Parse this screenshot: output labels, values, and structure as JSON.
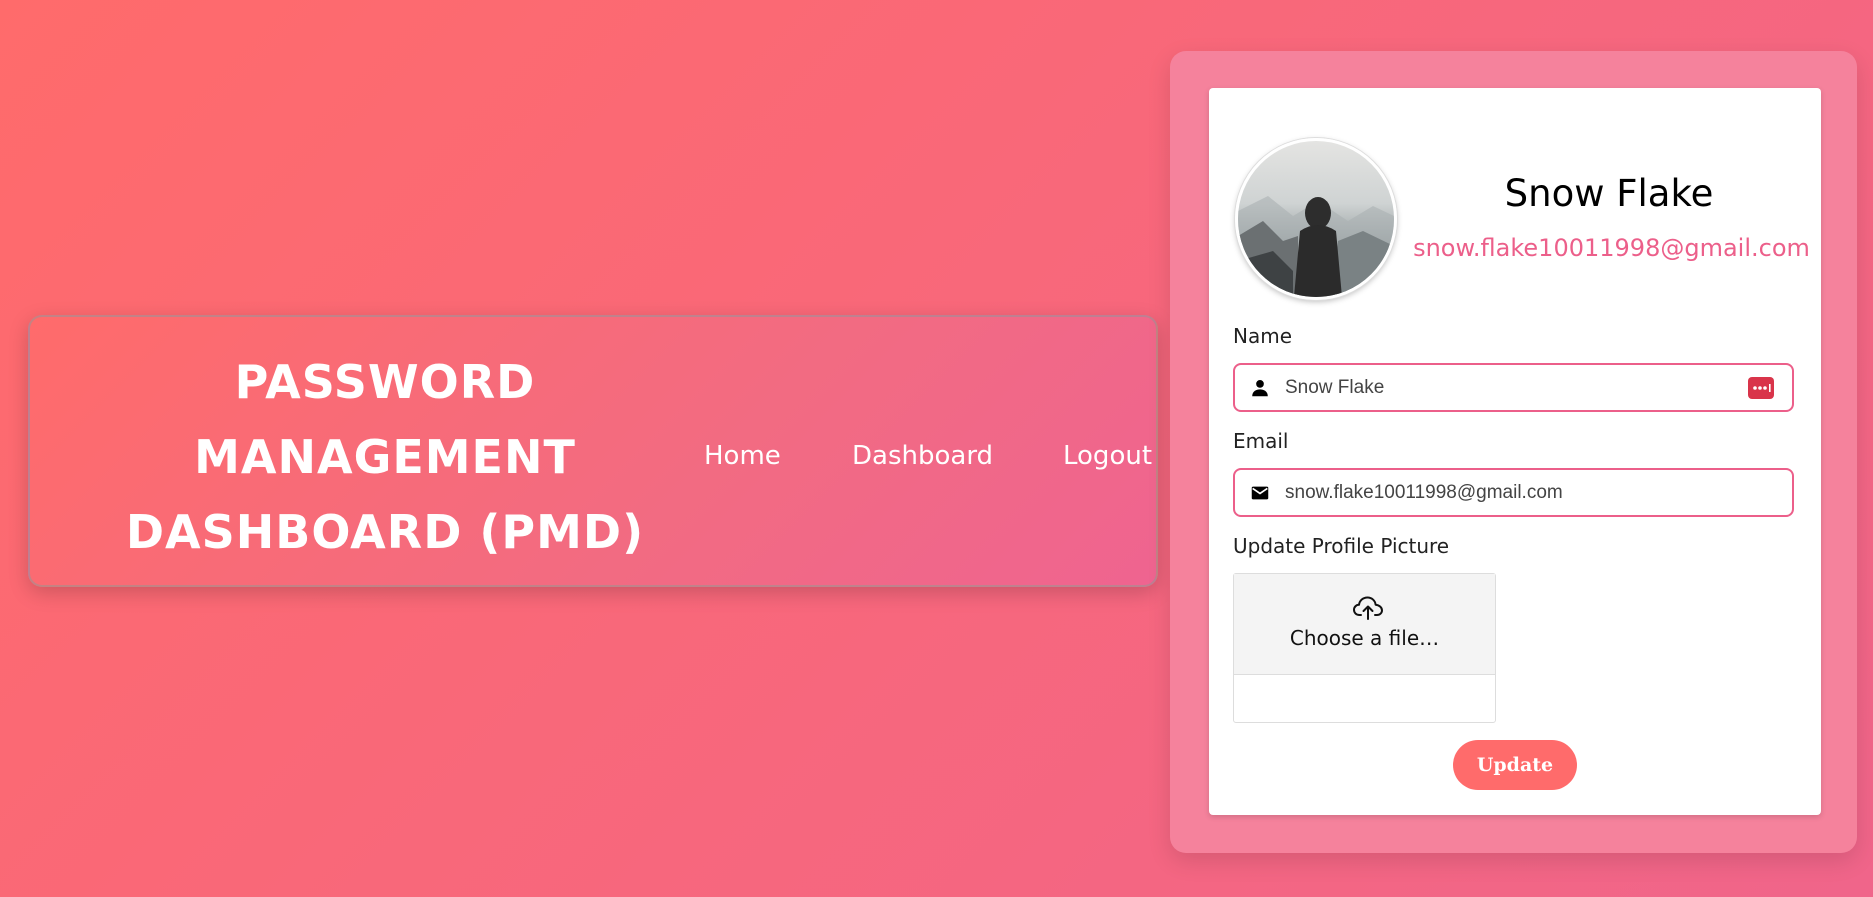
{
  "navbar": {
    "brand_line1": "PASSWORD",
    "brand_line2": "MANAGEMENT",
    "brand_line3": "DASHBOARD (PMD)",
    "links": [
      {
        "label": "Home"
      },
      {
        "label": "Dashboard"
      },
      {
        "label": "Logout"
      }
    ]
  },
  "profile": {
    "name": "Snow Flake",
    "email": "snow.flake10011998@gmail.com",
    "avatar_icon": "hooded-figure-mountains"
  },
  "form": {
    "name_label": "Name",
    "name_value": "Snow Flake",
    "name_icon": "user-icon",
    "password_manager_icon": "dots-badge-icon",
    "email_label": "Email",
    "email_value": "snow.flake10011998@gmail.com",
    "email_icon": "envelope-icon",
    "picture_label": "Update Profile Picture",
    "file_cta": "Choose a file…",
    "upload_icon": "cloud-upload-icon",
    "update_button": "Update"
  },
  "colors": {
    "accent": "#ec5f8a",
    "button": "#ff6b6b",
    "outer_card": "#f5829c"
  }
}
